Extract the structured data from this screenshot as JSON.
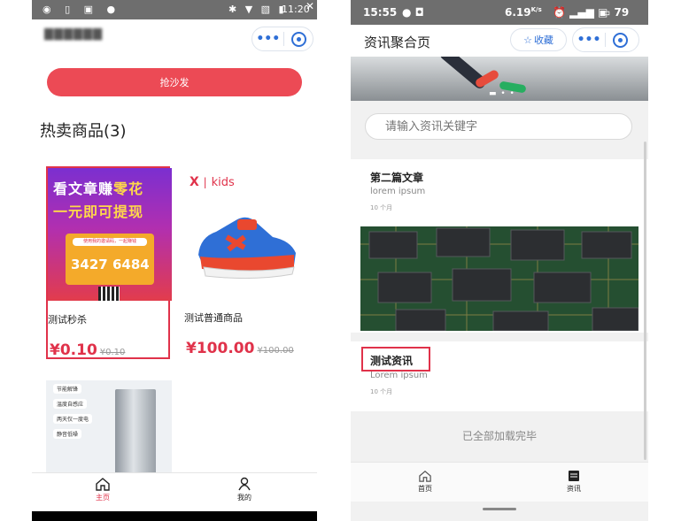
{
  "left_screen": {
    "status": {
      "time": "11:20"
    },
    "button_label": "抢沙发",
    "section_title": "热卖商品(3)",
    "products": [
      {
        "name": "测试秒杀",
        "price": "¥0.10",
        "original_price": "¥0.10",
        "promo_line1_a": "看文章赚",
        "promo_line1_b": "零花",
        "promo_line2": "一元即可提现",
        "promo_tag": "使用我的邀请码，一起赚钱",
        "promo_code": "3427 6484"
      },
      {
        "name": "测试普通商品",
        "price": "¥100.00",
        "original_price": "¥100.00",
        "brand": "kids"
      }
    ],
    "fridge_features": [
      "节能解锋",
      "温度自感应",
      "两天仅一度电",
      "静音低噪"
    ],
    "tabs": [
      {
        "label": "主页",
        "icon": "home-icon",
        "active": true
      },
      {
        "label": "我的",
        "icon": "person-icon",
        "active": false
      }
    ],
    "colors": {
      "accent": "#e0324a",
      "button": "#ec4a55",
      "capsule": "#2f6fd6"
    }
  },
  "right_screen": {
    "status": {
      "time": "15:55",
      "speed": "6.19",
      "speed_unit": "K/s",
      "battery": "79"
    },
    "page_title": "资讯聚合页",
    "favorite_label": "收藏",
    "search_placeholder": "请输入资讯关键字",
    "articles": [
      {
        "title": "第二篇文章",
        "subtitle": "lorem ipsum",
        "time": "10 个月"
      },
      {
        "title": "测试资讯",
        "subtitle": "Lorem ipsum",
        "time": "10 个月"
      }
    ],
    "end_text": "已全部加载完毕",
    "tabs": [
      {
        "label": "首页",
        "icon": "home-icon",
        "active": false
      },
      {
        "label": "资讯",
        "icon": "news-icon",
        "active": true
      }
    ]
  }
}
